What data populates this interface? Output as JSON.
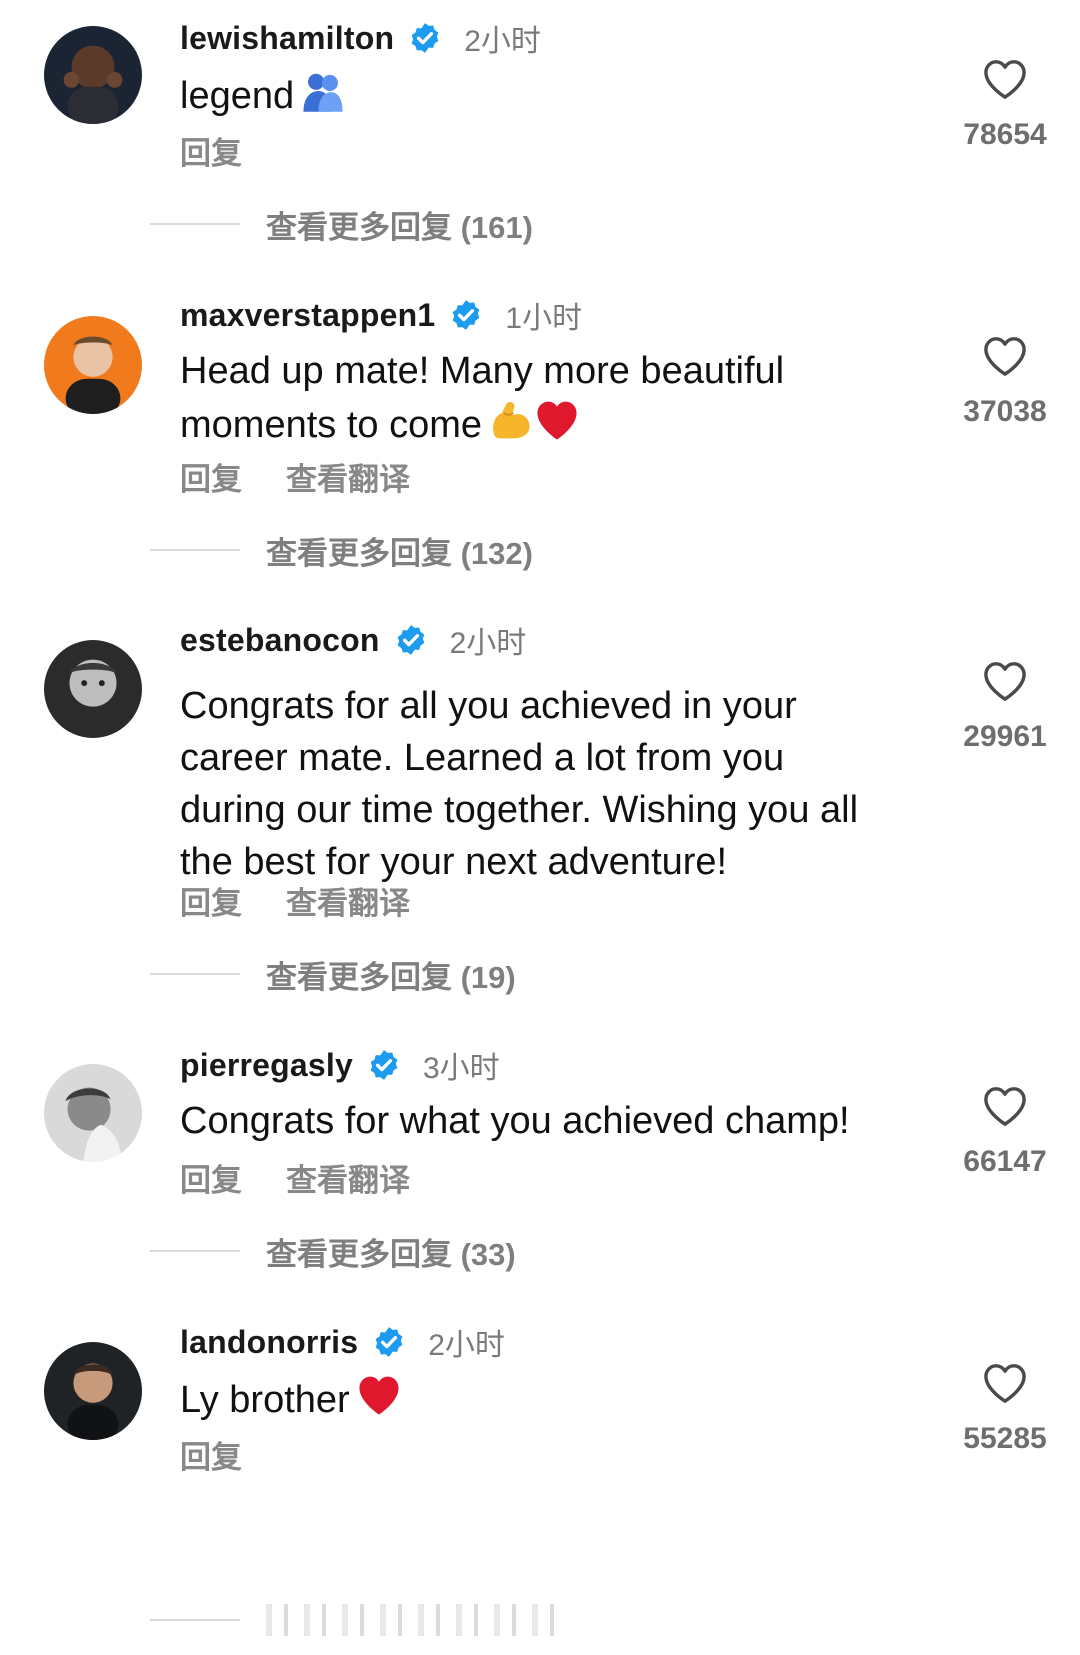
{
  "colors": {
    "verified_blue": "#1d9bf0",
    "heart_outline": "#4a4a4a",
    "secondary_text": "#7f7f7f",
    "emoji_heart_red": "#e0182d",
    "emoji_flex_yellow": "#f7b52c"
  },
  "comments": [
    {
      "username": "lewishamilton",
      "time": "2小时",
      "text": "legend",
      "emoji": "people-hugging-emoji",
      "actions": [
        "回复"
      ],
      "likes": "78654",
      "more_replies": "查看更多回复 (161)"
    },
    {
      "username": "maxverstappen1",
      "time": "1小时",
      "text": "Head up mate! Many more beautiful moments to come",
      "emoji": "flexed-biceps-and-red-heart-emoji",
      "actions": [
        "回复",
        "查看翻译"
      ],
      "likes": "37038",
      "more_replies": "查看更多回复 (132)"
    },
    {
      "username": "estebanocon",
      "time": "2小时",
      "text": "Congrats for all you achieved in your career mate. Learned a lot from you during our time together. Wishing you all the best for your next adventure!",
      "actions": [
        "回复",
        "查看翻译"
      ],
      "likes": "29961",
      "more_replies": "查看更多回复 (19)"
    },
    {
      "username": "pierregasly",
      "time": "3小时",
      "text": "Congrats for what you achieved champ!",
      "actions": [
        "回复",
        "查看翻译"
      ],
      "likes": "66147",
      "more_replies": "查看更多回复 (33)"
    },
    {
      "username": "landonorris",
      "time": "2小时",
      "text": "Ly brother",
      "emoji": "red-heart-emoji",
      "actions": [
        "回复"
      ],
      "likes": "55285"
    }
  ]
}
